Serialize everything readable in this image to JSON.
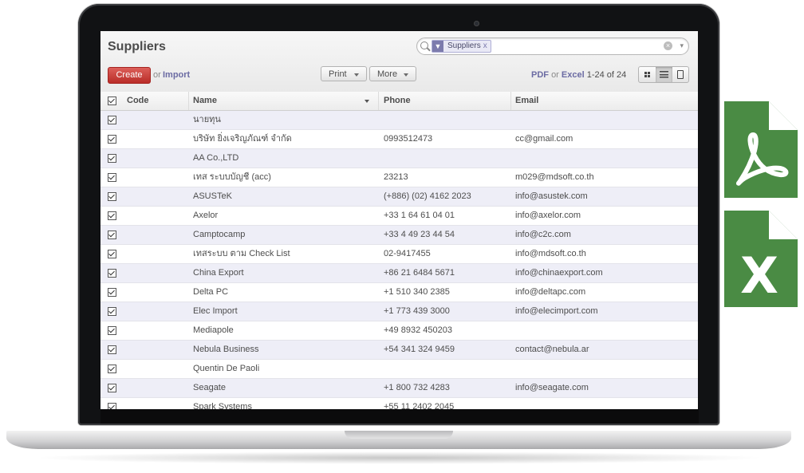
{
  "page": {
    "title": "Suppliers"
  },
  "search": {
    "facet_label": "Suppliers",
    "facet_close": "x",
    "clear_glyph": "×",
    "dropdown_glyph": "▾"
  },
  "toolbar": {
    "create_label": "Create",
    "or_label": "or",
    "import_label": "Import",
    "print_label": "Print",
    "more_label": "More",
    "pdf_label": "PDF",
    "or2_label": "or",
    "excel_label": "Excel",
    "pager": "1-24 of 24",
    "views": [
      "kanban-icon",
      "list-icon",
      "form-icon"
    ],
    "active_view": "list"
  },
  "table": {
    "columns": [
      "Code",
      "Name",
      "Phone",
      "Email"
    ],
    "rows": [
      {
        "code": "",
        "name": "นายทุน",
        "phone": "",
        "email": ""
      },
      {
        "code": "",
        "name": "บริษัท ยิ่งเจริญภัณฑ์ จำกัด",
        "phone": "0993512473",
        "email": "cc@gmail.com"
      },
      {
        "code": "",
        "name": "AA Co.,LTD",
        "phone": "",
        "email": ""
      },
      {
        "code": "",
        "name": "เทส ระบบบัญชี (acc)",
        "phone": "23213",
        "email": "m029@mdsoft.co.th"
      },
      {
        "code": "",
        "name": "ASUSTeK",
        "phone": "(+886) (02) 4162 2023",
        "email": "info@asustek.com"
      },
      {
        "code": "",
        "name": "Axelor",
        "phone": "+33 1 64 61 04 01",
        "email": "info@axelor.com"
      },
      {
        "code": "",
        "name": "Camptocamp",
        "phone": "+33 4 49 23 44 54",
        "email": "info@c2c.com"
      },
      {
        "code": "",
        "name": "เทสระบบ ตาม Check List",
        "phone": "02-9417455",
        "email": "info@mdsoft.co.th"
      },
      {
        "code": "",
        "name": "China Export",
        "phone": "+86 21 6484 5671",
        "email": "info@chinaexport.com"
      },
      {
        "code": "",
        "name": "Delta PC",
        "phone": "+1 510 340 2385",
        "email": "info@deltapc.com"
      },
      {
        "code": "",
        "name": "Elec Import",
        "phone": "+1 773 439 3000",
        "email": "info@elecimport.com"
      },
      {
        "code": "",
        "name": "Mediapole",
        "phone": "+49 8932 450203",
        "email": ""
      },
      {
        "code": "",
        "name": "Nebula Business",
        "phone": "+54 341 324 9459",
        "email": "contact@nebula.ar"
      },
      {
        "code": "",
        "name": "Quentin De Paoli",
        "phone": "",
        "email": ""
      },
      {
        "code": "",
        "name": "Seagate",
        "phone": "+1 800 732 4283",
        "email": "info@seagate.com"
      },
      {
        "code": "",
        "name": "Spark Systems",
        "phone": "+55 11 2402 2045",
        "email": ""
      }
    ]
  },
  "exports": [
    {
      "name": "pdf-file-icon",
      "color": "#4a8b44"
    },
    {
      "name": "excel-file-icon",
      "color": "#4a8b44",
      "glyph": "X"
    }
  ],
  "colors": {
    "create": "#c9302c",
    "link": "#6b6ba3",
    "row_alt": "#eeeef7",
    "export_green": "#4a8b44"
  }
}
